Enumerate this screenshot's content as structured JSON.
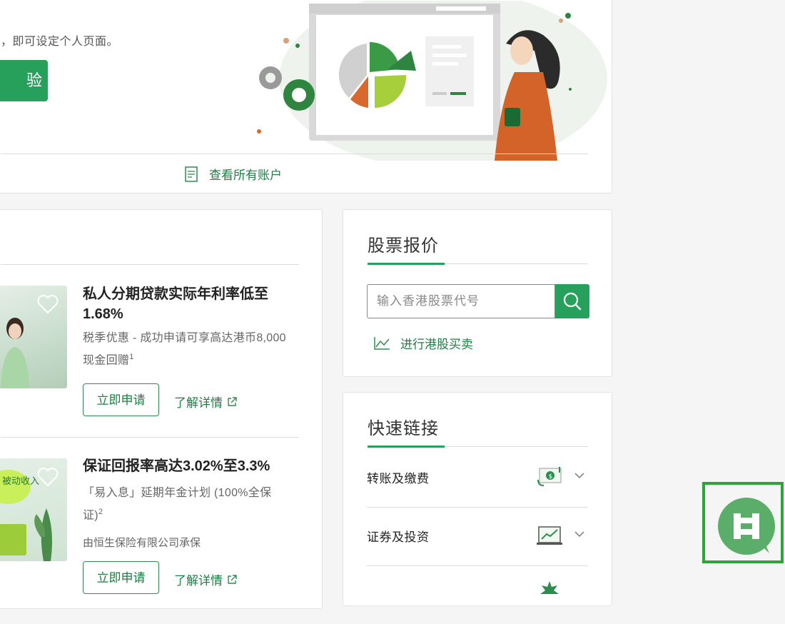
{
  "banner": {
    "text": "，即可设定个人页面。",
    "button_label": "验",
    "view_all_label": "查看所有账户"
  },
  "promos": [
    {
      "title": "私人分期贷款实际年利率低至1.68%",
      "desc": "税季优惠 - 成功申请可享高达港币8,000现金回赠",
      "desc_sup": "1",
      "sub": "",
      "apply_label": "立即申请",
      "learn_label": "了解详情"
    },
    {
      "title": "保证回报率高达3.02%至3.3%",
      "desc": "「易入息」延期年金计划 (100%全保证)",
      "desc_sup": "2",
      "sub": "由恒生保险有限公司承保",
      "apply_label": "立即申请",
      "learn_label": "了解详情",
      "img_text": "被动收入"
    }
  ],
  "stock": {
    "title": "股票报价",
    "search_placeholder": "输入香港股票代号",
    "trade_label": "进行港股买卖"
  },
  "quick_links": {
    "title": "快速链接",
    "items": [
      {
        "label": "转账及缴费",
        "icon": "money-transfer-icon"
      },
      {
        "label": "证券及投资",
        "icon": "investment-chart-icon"
      },
      {
        "label": "",
        "icon": "star-icon"
      }
    ]
  },
  "colors": {
    "brand_green": "#27a05c",
    "link_green": "#1e7e44",
    "chat_green": "#5aae6a",
    "frame_green": "#2da338"
  }
}
